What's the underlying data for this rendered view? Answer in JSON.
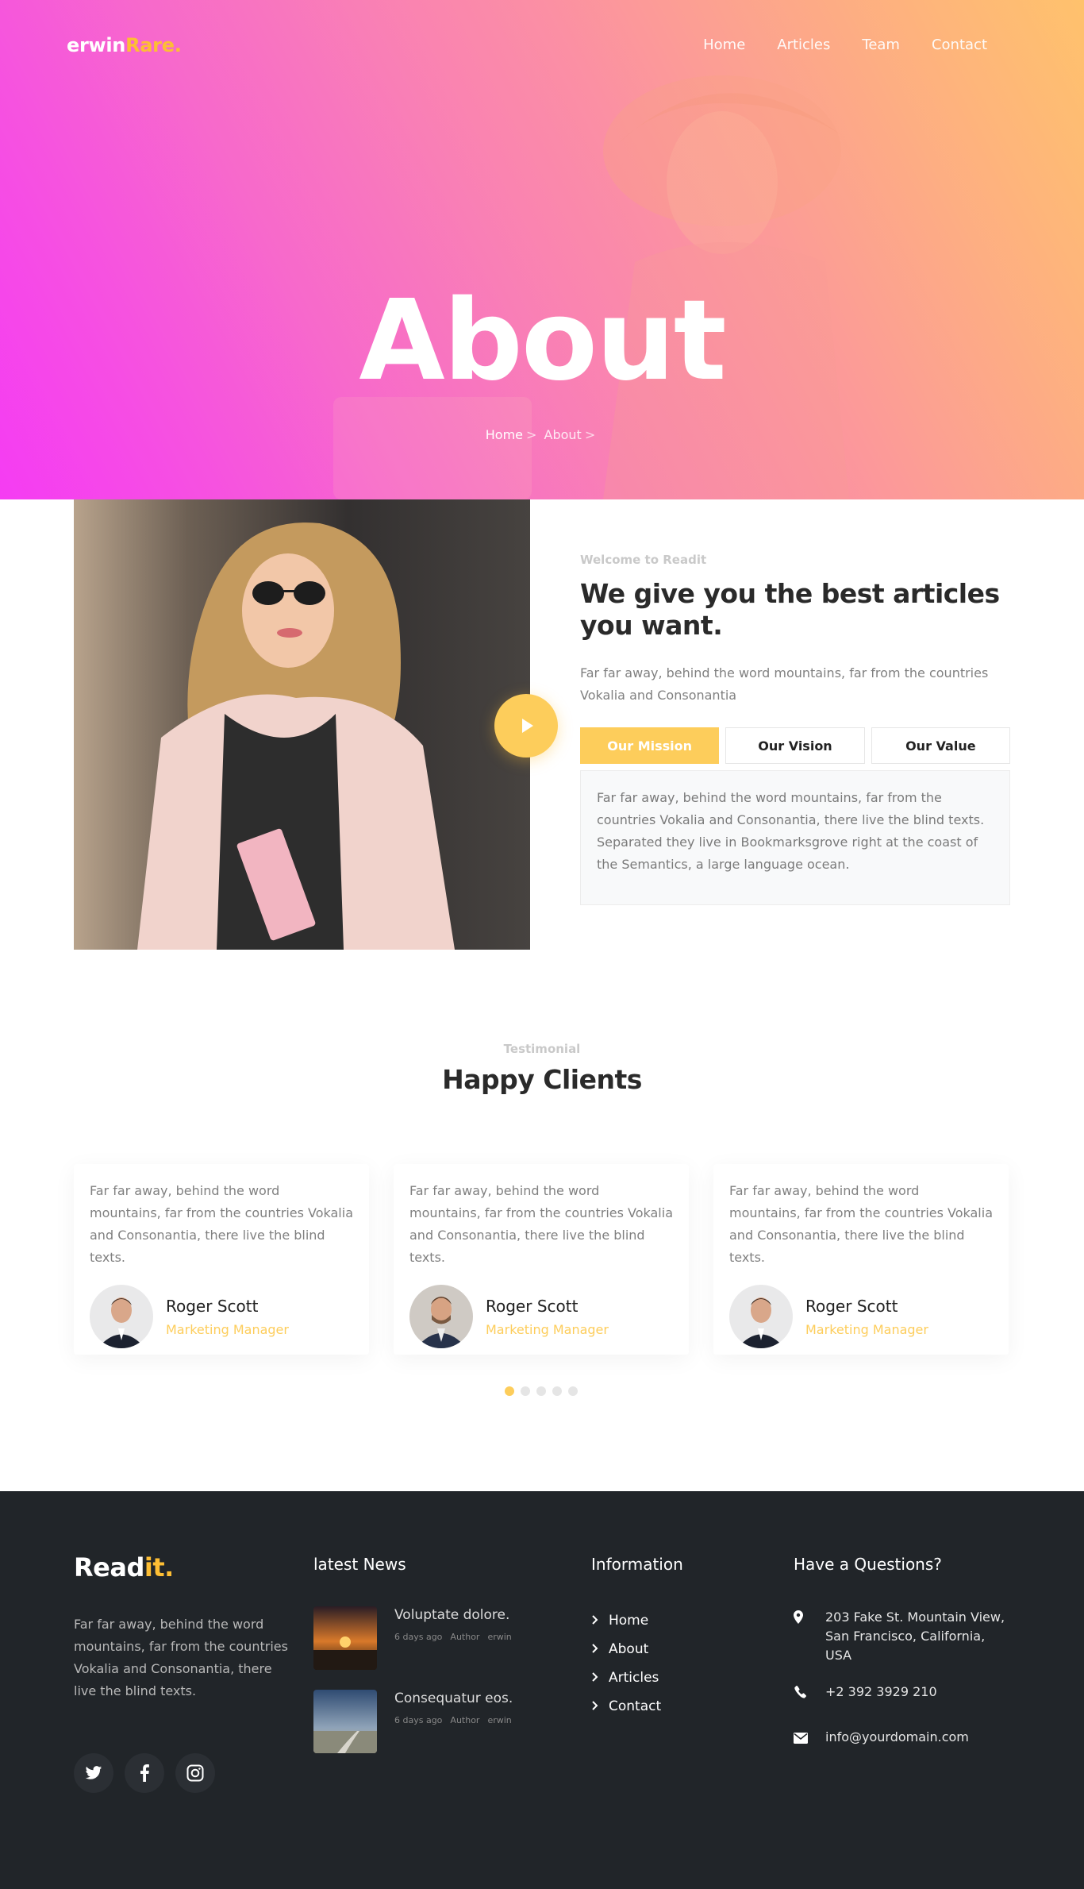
{
  "header": {
    "logo_main": "erwin",
    "logo_accent": "Rare.",
    "nav": [
      "Home",
      "Articles",
      "Team",
      "Contact"
    ]
  },
  "hero": {
    "title": "About",
    "breadcrumb": [
      "Home",
      "About"
    ],
    "breadcrumb_separator": ">"
  },
  "about": {
    "subheading": "Welcome to Readit",
    "heading": "We give you the best articles you want.",
    "text": "Far far away, behind the word mountains, far from the countries Vokalia and Consonantia",
    "tabs": [
      "Our Mission",
      "Our Vision",
      "Our Value"
    ],
    "active_tab": "Our Mission",
    "panel_text": "Far far away, behind the word mountains, far from the countries Vokalia and Consonantia, there live the blind texts. Separated they live in Bookmarksgrove right at the coast of the Semantics, a large language ocean."
  },
  "testimonials": {
    "subheading": "Testimonial",
    "heading": "Happy Clients",
    "items": [
      {
        "text": "Far far away, behind the word mountains, far from the countries Vokalia and Consonantia, there live the blind texts.",
        "name": "Roger Scott",
        "role": "Marketing Manager"
      },
      {
        "text": "Far far away, behind the word mountains, far from the countries Vokalia and Consonantia, there live the blind texts.",
        "name": "Roger Scott",
        "role": "Marketing Manager"
      },
      {
        "text": "Far far away, behind the word mountains, far from the countries Vokalia and Consonantia, there live the blind texts.",
        "name": "Roger Scott",
        "role": "Marketing Manager"
      }
    ],
    "pagination_count": 5,
    "active_dot": 1
  },
  "footer": {
    "logo_main": "Read",
    "logo_accent": "it.",
    "about_text": "Far far away, behind the word mountains, far from the countries Vokalia and Consonantia, there live the blind texts.",
    "socials": [
      "twitter-icon",
      "facebook-icon",
      "instagram-icon"
    ],
    "news_title": "latest News",
    "news": [
      {
        "title": "Voluptate dolore.",
        "date": "6 days ago",
        "author_label": "Author",
        "author": "erwin"
      },
      {
        "title": "Consequatur eos.",
        "date": "6 days ago",
        "author_label": "Author",
        "author": "erwin"
      }
    ],
    "info_title": "Information",
    "links": [
      "Home",
      "About",
      "Articles",
      "Contact"
    ],
    "contact_title": "Have a Questions?",
    "address": "203 Fake St. Mountain View, San Francisco, California, USA",
    "phone": "+2 392 3929 210",
    "email": "info@yourdomain.com"
  },
  "colors": {
    "accent": "#fdcd5b",
    "hero_pink": "#f53cf3",
    "hero_orange": "#ffc56b",
    "footer_bg": "#212529"
  }
}
